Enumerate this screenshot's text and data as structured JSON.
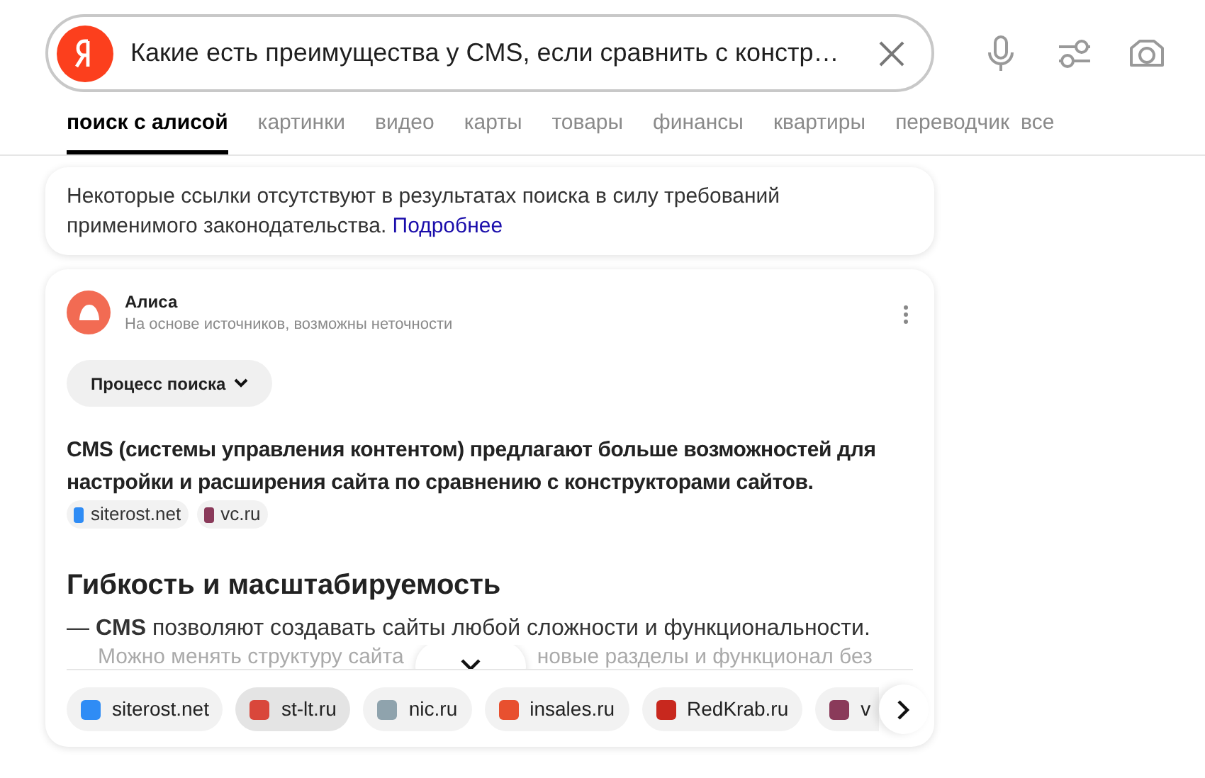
{
  "search": {
    "query": "Какие есть преимущества у CMS, если сравнить с констр…"
  },
  "tabs": [
    {
      "label": "поиск с алисой",
      "selected": true
    },
    {
      "label": "картинки",
      "selected": false
    },
    {
      "label": "видео",
      "selected": false
    },
    {
      "label": "карты",
      "selected": false
    },
    {
      "label": "товары",
      "selected": false
    },
    {
      "label": "финансы",
      "selected": false
    },
    {
      "label": "квартиры",
      "selected": false
    },
    {
      "label": "переводчик",
      "selected": false
    },
    {
      "label": "все",
      "selected": false
    }
  ],
  "notice": {
    "text": "Некоторые ссылки отсутствуют в результатах поиска в силу требований применимого законодательства.",
    "link": "Подробнее"
  },
  "answer": {
    "author": "Алиса",
    "subtitle": "На основе источников, возможны неточности",
    "process_button": "Процесс поиска",
    "summary": "CMS (системы управления контентом) предлагают больше возможностей для настройки и расширения сайта по сравнению с конструкторами сайтов.",
    "summary_sources": [
      {
        "label": "siterost.net",
        "color": "#2f8cf5"
      },
      {
        "label": "vc.ru",
        "color": "#8a3a5a"
      }
    ],
    "heading": "Гибкость и масштабируемость",
    "bullet": "— **CMS** позволяют создавать сайты любой сложности и функциональности.",
    "cut_line": [
      "Можно менять структуру сайта",
      "новые разделы и функционал без"
    ],
    "sources": [
      {
        "label": "siterost.net",
        "color": "#2f8cf5",
        "selected": false
      },
      {
        "label": "st-lt.ru",
        "color": "#d9473b",
        "selected": true
      },
      {
        "label": "nic.ru",
        "color": "#8fa3ad",
        "selected": false
      },
      {
        "label": "insales.ru",
        "color": "#e8502f",
        "selected": false
      },
      {
        "label": "RedKrab.ru",
        "color": "#c8281e",
        "selected": false
      },
      {
        "label": "v",
        "color": "#8a3a5a",
        "selected": false
      }
    ]
  }
}
